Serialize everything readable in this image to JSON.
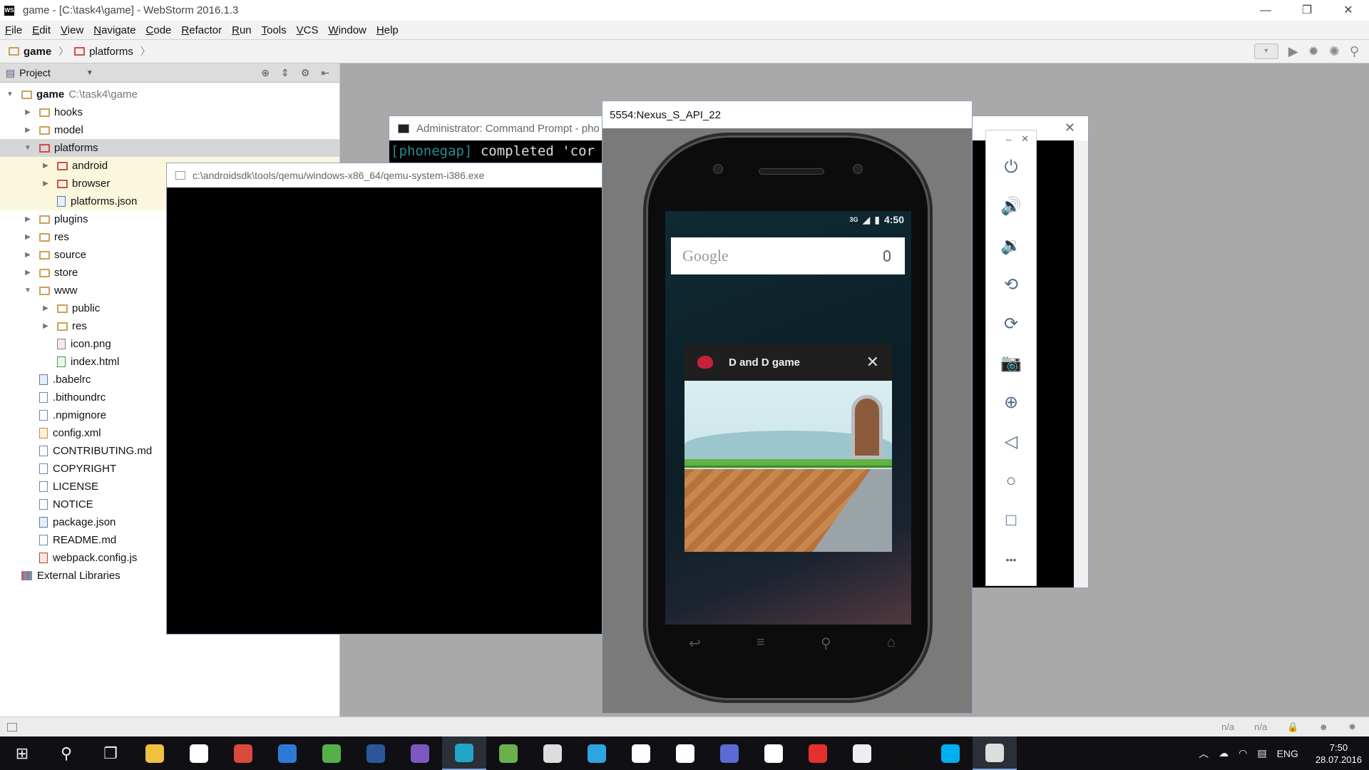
{
  "window": {
    "title": "game - [C:\\task4\\game] - WebStorm 2016.1.3",
    "logo": "WS",
    "controls": [
      "—",
      "❐",
      "✕"
    ]
  },
  "menu": [
    "File",
    "Edit",
    "View",
    "Navigate",
    "Code",
    "Refactor",
    "Run",
    "Tools",
    "VCS",
    "Window",
    "Help"
  ],
  "breadcrumb": {
    "root": "game",
    "child": "platforms"
  },
  "project_panel": {
    "header": "Project",
    "tree": [
      {
        "label": "game",
        "extra": "C:\\task4\\game",
        "depth": 0,
        "kind": "folder",
        "open": true,
        "bold": true
      },
      {
        "label": "hooks",
        "depth": 1,
        "kind": "folder",
        "open": false
      },
      {
        "label": "model",
        "depth": 1,
        "kind": "folder",
        "open": false
      },
      {
        "label": "platforms",
        "depth": 1,
        "kind": "folder-red",
        "open": true,
        "selected": true
      },
      {
        "label": "android",
        "depth": 2,
        "kind": "folder-red",
        "open": false,
        "highlight": true
      },
      {
        "label": "browser",
        "depth": 2,
        "kind": "folder-red",
        "open": false,
        "highlight": true
      },
      {
        "label": "platforms.json",
        "depth": 2,
        "kind": "json",
        "highlight": true
      },
      {
        "label": "plugins",
        "depth": 1,
        "kind": "folder",
        "open": false
      },
      {
        "label": "res",
        "depth": 1,
        "kind": "folder",
        "open": false
      },
      {
        "label": "source",
        "depth": 1,
        "kind": "folder",
        "open": false
      },
      {
        "label": "store",
        "depth": 1,
        "kind": "folder",
        "open": false
      },
      {
        "label": "www",
        "depth": 1,
        "kind": "folder",
        "open": true
      },
      {
        "label": "public",
        "depth": 2,
        "kind": "folder",
        "open": false
      },
      {
        "label": "res",
        "depth": 2,
        "kind": "folder",
        "open": false
      },
      {
        "label": "icon.png",
        "depth": 2,
        "kind": "img"
      },
      {
        "label": "index.html",
        "depth": 2,
        "kind": "html"
      },
      {
        "label": ".babelrc",
        "depth": 1,
        "kind": "json"
      },
      {
        "label": ".bithoundrc",
        "depth": 1,
        "kind": "file"
      },
      {
        "label": ".npmignore",
        "depth": 1,
        "kind": "file"
      },
      {
        "label": "config.xml",
        "depth": 1,
        "kind": "xml"
      },
      {
        "label": "CONTRIBUTING.md",
        "depth": 1,
        "kind": "file"
      },
      {
        "label": "COPYRIGHT",
        "depth": 1,
        "kind": "file"
      },
      {
        "label": "LICENSE",
        "depth": 1,
        "kind": "file"
      },
      {
        "label": "NOTICE",
        "depth": 1,
        "kind": "file"
      },
      {
        "label": "package.json",
        "depth": 1,
        "kind": "json"
      },
      {
        "label": "README.md",
        "depth": 1,
        "kind": "file"
      },
      {
        "label": "webpack.config.js",
        "depth": 1,
        "kind": "js"
      },
      {
        "label": "External Libraries",
        "depth": 0,
        "kind": "lib"
      }
    ]
  },
  "qemu_window": {
    "title": "c:\\androidsdk\\tools/qemu/windows-x86_64/qemu-system-i386.exe"
  },
  "cmd_window": {
    "title": "Administrator: Command Prompt - pho",
    "line_prefix": "[phonegap]",
    "line_text": " completed 'cor"
  },
  "emulator": {
    "title": "5554:Nexus_S_API_22",
    "status_time": "4:50",
    "status_net": "3G",
    "search_logo": "Google",
    "recent_app_title": "D and D game",
    "close_glyph": "✕",
    "nav_keys": [
      "↩",
      "≡",
      "⚲",
      "⌂"
    ]
  },
  "emulator_controls": {
    "top": [
      "–",
      "✕"
    ],
    "buttons": [
      {
        "name": "power-icon",
        "glyph": "⏻"
      },
      {
        "name": "volume-up-icon",
        "glyph": "🔊"
      },
      {
        "name": "volume-down-icon",
        "glyph": "🔉"
      },
      {
        "name": "rotate-left-icon",
        "glyph": "⟲"
      },
      {
        "name": "rotate-right-icon",
        "glyph": "⟳"
      },
      {
        "name": "camera-icon",
        "glyph": "📷"
      },
      {
        "name": "zoom-icon",
        "glyph": "⊕"
      },
      {
        "name": "back-icon",
        "glyph": "◁"
      },
      {
        "name": "home-icon",
        "glyph": "○"
      },
      {
        "name": "overview-icon",
        "glyph": "□"
      },
      {
        "name": "more-icon",
        "glyph": "•••"
      }
    ]
  },
  "statusbar": {
    "right": [
      "n/a",
      "n/a"
    ]
  },
  "taskbar": {
    "apps": [
      {
        "name": "start-icon",
        "glyph": "⊞"
      },
      {
        "name": "search-icon",
        "glyph": "⚲"
      },
      {
        "name": "task-view-icon",
        "glyph": "❐"
      },
      {
        "name": "file-explorer-icon",
        "color": "#f0c040"
      },
      {
        "name": "foxy-app-icon",
        "color": "#ffffff"
      },
      {
        "name": "chrome-icon",
        "color": "#d94a3a"
      },
      {
        "name": "edge-icon",
        "color": "#2d7ad6"
      },
      {
        "name": "utorrent-icon",
        "color": "#55b04a"
      },
      {
        "name": "word-icon",
        "color": "#2b579a"
      },
      {
        "name": "visual-studio-icon",
        "color": "#7e57c2"
      },
      {
        "name": "webstorm-icon",
        "color": "#20a5c8",
        "active": true
      },
      {
        "name": "android-studio-icon",
        "color": "#6ab04c"
      },
      {
        "name": "movie-maker-icon",
        "color": "#dddddd"
      },
      {
        "name": "telegram-icon",
        "color": "#2ca5e0"
      },
      {
        "name": "slack-icon",
        "color": "#ffffff"
      },
      {
        "name": "steam-icon",
        "color": "#ffffff"
      },
      {
        "name": "save-icon",
        "color": "#5b6bd6"
      },
      {
        "name": "github-icon",
        "color": "#ffffff"
      },
      {
        "name": "yandex-icon",
        "color": "#e63030"
      },
      {
        "name": "drive-icon",
        "color": "#eeeeee"
      },
      {
        "name": "cmd-icon",
        "color": "#111111"
      },
      {
        "name": "skype-icon",
        "color": "#00aff0"
      },
      {
        "name": "emulator-icon",
        "color": "#dddddd",
        "active": true
      }
    ],
    "tray_lang": "ENG",
    "clock_time": "7:50",
    "clock_date": "28.07.2016"
  }
}
